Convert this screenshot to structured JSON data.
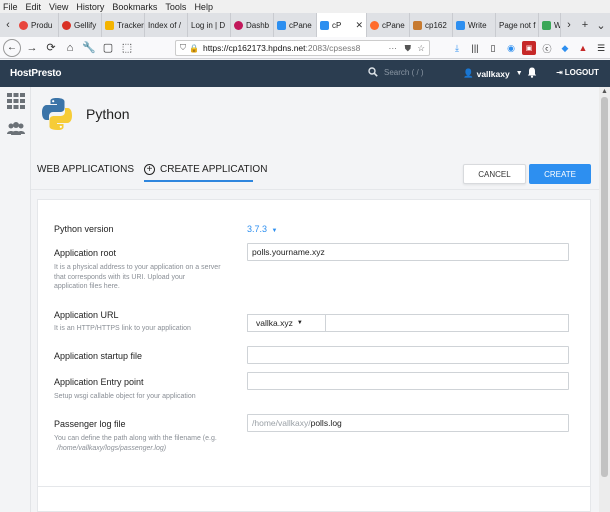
{
  "menubar": {
    "items": [
      "File",
      "Edit",
      "View",
      "History",
      "Bookmarks",
      "Tools",
      "Help"
    ]
  },
  "browser_tabs": [
    {
      "label": "Produ",
      "color": "#e8453c"
    },
    {
      "label": "Gellify",
      "color": "#d93025"
    },
    {
      "label": "Tracker",
      "color": "#f4b400"
    },
    {
      "label": "Index of /",
      "color": "#dfe1e5"
    },
    {
      "label": "Log in | D",
      "color": "#dfe1e5"
    },
    {
      "label": "Dashb",
      "color": "#c2185b"
    },
    {
      "label": "cPane",
      "color": "#2d8ff0"
    },
    {
      "label": "cP",
      "color": "#2d8ff0",
      "active": true
    },
    {
      "label": "cPane",
      "color": "#ff6c2c"
    },
    {
      "label": "cp162",
      "color": "#c77a30"
    },
    {
      "label": "Write",
      "color": "#2d8ff0"
    },
    {
      "label": "Page not f",
      "color": "#dfe1e5"
    },
    {
      "label": "W",
      "color": "#3aa757"
    }
  ],
  "navbar": {
    "url_host": "https://cp162173.hpdns.net",
    "url_path": ":2083/cpsess8"
  },
  "app": {
    "logo": "HostPresto",
    "search_placeholder": "Search ( / )",
    "username": "vallkaxy",
    "logout": "LOGOUT"
  },
  "page": {
    "title": "Python",
    "tab_web": "WEB APPLICATIONS",
    "tab_create": "CREATE APPLICATION",
    "cancel": "CANCEL",
    "create": "CREATE"
  },
  "form": {
    "python_version_label": "Python version",
    "python_version_value": "3.7.3",
    "app_root_label": "Application root",
    "app_root_value": "polls.yourname.xyz",
    "app_root_hint_1": "It is a physical address to your application on a server",
    "app_root_hint_2": "that corresponds with its URI. Upload your",
    "app_root_hint_3": "application files here.",
    "app_url_label": "Application URL",
    "app_url_hint": "It is an HTTP/HTTPS link to your application",
    "app_url_domain": "vallka.xyz",
    "startup_label": "Application startup file",
    "entry_label": "Application Entry point",
    "entry_hint": "Setup wsgi callable object for your application",
    "log_label": "Passenger log file",
    "log_prefix": "/home/vallkaxy/",
    "log_value": "polls.log",
    "log_hint_1": "You can define the path along with the filename (e.g.",
    "log_hint_2": "/home/vallkaxy/logs/passenger.log)"
  }
}
